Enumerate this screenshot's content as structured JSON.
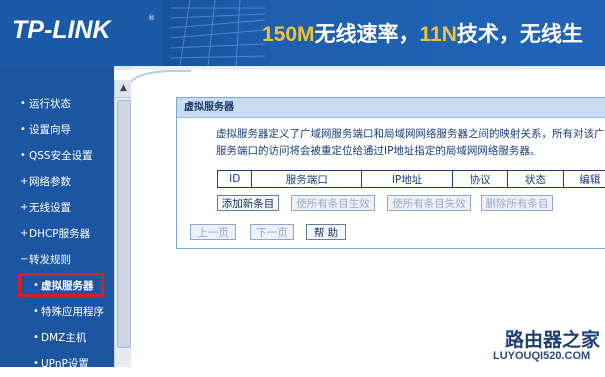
{
  "header": {
    "logo": "TP-LINK",
    "logo_reg": "®",
    "tagline_prefix": "150M",
    "tagline_rest": "无线速率，",
    "tagline_11n": "11N",
    "tagline_tail": "技术，无线生"
  },
  "sidebar": {
    "items": [
      {
        "label": "运行状态",
        "bullet": "•"
      },
      {
        "label": "设置向导",
        "bullet": "•"
      },
      {
        "label": "QSS安全设置",
        "bullet": "•"
      },
      {
        "label": "网络参数",
        "bullet": "+"
      },
      {
        "label": "无线设置",
        "bullet": "+"
      },
      {
        "label": "DHCP服务器",
        "bullet": "+"
      },
      {
        "label": "转发规则",
        "bullet": "−"
      },
      {
        "label": "虚拟服务器",
        "bullet": "•"
      },
      {
        "label": "特殊应用程序",
        "bullet": "•"
      },
      {
        "label": "DMZ主机",
        "bullet": "•"
      },
      {
        "label": "UPnP设置",
        "bullet": "•"
      }
    ],
    "scroll_up_icon": "▲"
  },
  "panel": {
    "title": "虚拟服务器",
    "desc_line1": "虚拟服务器定义了广域网服务端口和局域网网络服务器之间的映射关系，所有对该广",
    "desc_line2": "服务端口的访问将会被重定位给通过IP地址指定的局域网网络服务器。",
    "columns": [
      "ID",
      "服务端口",
      "IP地址",
      "协议",
      "状态",
      "编辑"
    ],
    "buttons": {
      "add": "添加新条目",
      "enable_all": "使所有条目生效",
      "disable_all": "使所有条目失效",
      "delete_all": "删除所有条目"
    }
  },
  "pager": {
    "prev": "上一页",
    "next": "下一页",
    "help": "帮 助"
  },
  "watermark": {
    "title": "路由器之家",
    "url": "LUYOUQI520.COM"
  },
  "colors": {
    "sidebar_bg": "#1c56a2",
    "panel_header": "#c9dcf2",
    "highlight": "#d7201c",
    "text_blue": "#1b3d78"
  }
}
